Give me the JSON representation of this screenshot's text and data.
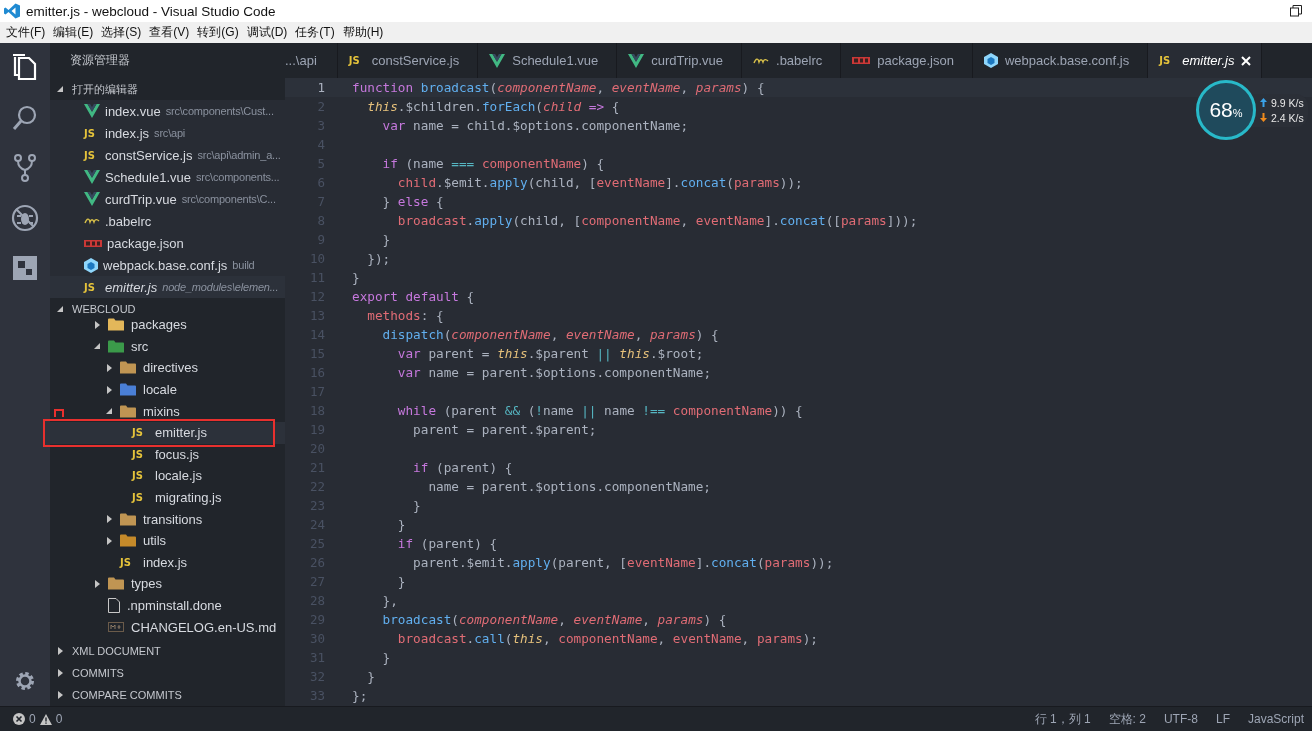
{
  "window": {
    "title": "emitter.js - webcloud - Visual Studio Code"
  },
  "menu": [
    "文件(F)",
    "编辑(E)",
    "选择(S)",
    "查看(V)",
    "转到(G)",
    "调试(D)",
    "任务(T)",
    "帮助(H)"
  ],
  "activity_bar": [
    {
      "kind": "explorer",
      "selected": true
    },
    {
      "kind": "search",
      "selected": false
    },
    {
      "kind": "git",
      "selected": false
    },
    {
      "kind": "debug",
      "selected": false
    },
    {
      "kind": "extensions",
      "selected": false
    }
  ],
  "sidebar": {
    "title": "资源管理器",
    "open_editors": {
      "title": "打开的编辑器",
      "expanded": true,
      "items": [
        {
          "kind": "vue",
          "name": "index.vue",
          "path": "src\\components\\Cust...",
          "selected": false,
          "preview": false
        },
        {
          "kind": "js",
          "badge": "JS",
          "name": "index.js",
          "path": "src\\api",
          "selected": false,
          "preview": false
        },
        {
          "kind": "js",
          "badge": "JS",
          "name": "constService.js",
          "path": "src\\api\\admin_a...",
          "selected": false,
          "preview": false
        },
        {
          "kind": "vue",
          "name": "Schedule1.vue",
          "path": "src\\components...",
          "selected": false,
          "preview": false
        },
        {
          "kind": "vue",
          "name": "curdTrip.vue",
          "path": "src\\components\\C...",
          "selected": false,
          "preview": false
        },
        {
          "kind": "babel",
          "name": ".babelrc",
          "selected": false,
          "preview": false
        },
        {
          "kind": "npm",
          "name": "package.json",
          "selected": false,
          "preview": false
        },
        {
          "kind": "webpack",
          "name": "webpack.base.conf.js",
          "path": "build",
          "selected": false,
          "preview": false
        },
        {
          "kind": "js",
          "badge": "JS",
          "name": "emitter.js",
          "path": "node_modules\\elemen...",
          "selected": true,
          "preview": true
        }
      ]
    },
    "project": {
      "title": "WEBCLOUD",
      "expanded": true,
      "items": [
        {
          "kind": "packages-folder",
          "name": "packages",
          "expanded": false,
          "selected": false
        },
        {
          "kind": "src-folder",
          "name": "src",
          "expanded": true,
          "selected": false,
          "children": [
            {
              "kind": "folder",
              "name": "directives",
              "expanded": false,
              "selected": false
            },
            {
              "kind": "locale-folder",
              "name": "locale",
              "expanded": false,
              "selected": false
            },
            {
              "kind": "folder",
              "name": "mixins",
              "expanded": true,
              "selected": false,
              "children": [
                {
                  "kind": "js",
                  "badge": "JS",
                  "name": "emitter.js",
                  "selected": true
                },
                {
                  "kind": "js",
                  "badge": "JS",
                  "name": "focus.js",
                  "selected": false
                },
                {
                  "kind": "js",
                  "badge": "JS",
                  "name": "locale.js",
                  "selected": false
                },
                {
                  "kind": "js",
                  "badge": "JS",
                  "name": "migrating.js",
                  "selected": false
                }
              ]
            },
            {
              "kind": "folder",
              "name": "transitions",
              "expanded": false,
              "selected": false
            },
            {
              "kind": "utils-folder",
              "name": "utils",
              "expanded": false,
              "selected": false
            },
            {
              "kind": "js",
              "badge": "JS",
              "name": "index.js",
              "selected": false
            }
          ]
        },
        {
          "kind": "folder",
          "name": "types",
          "expanded": false,
          "selected": false
        },
        {
          "kind": "file",
          "name": ".npminstall.done",
          "selected": false
        },
        {
          "kind": "md",
          "name": "CHANGELOG.en-US.md",
          "selected": false
        }
      ]
    },
    "sections": [
      {
        "title": "XML DOCUMENT",
        "expanded": false
      },
      {
        "title": "COMMITS",
        "expanded": false
      },
      {
        "title": "COMPARE COMMITS",
        "expanded": false
      }
    ]
  },
  "tabs": [
    {
      "kind": "none",
      "label": "...\\api",
      "selected": false
    },
    {
      "kind": "js",
      "badge": "JS",
      "label": "constService.js",
      "selected": false
    },
    {
      "kind": "vue",
      "label": "Schedule1.vue",
      "selected": false
    },
    {
      "kind": "vue",
      "label": "curdTrip.vue",
      "selected": false
    },
    {
      "kind": "babel",
      "label": ".babelrc",
      "selected": false
    },
    {
      "kind": "npm",
      "label": "package.json",
      "selected": false
    },
    {
      "kind": "webpack",
      "label": "webpack.base.conf.js",
      "selected": false
    },
    {
      "kind": "js",
      "badge": "JS",
      "label": "emitter.js",
      "selected": true
    }
  ],
  "editor": {
    "lines": [
      {
        "n": "1",
        "current": true,
        "tokens": [
          {
            "text": "function ",
            "kind": "kw"
          },
          {
            "text": "broadcast",
            "kind": "fn"
          },
          {
            "text": "(",
            "kind": "p"
          },
          {
            "text": "componentName",
            "kind": "param"
          },
          {
            "text": ", ",
            "kind": "p"
          },
          {
            "text": "eventName",
            "kind": "param"
          },
          {
            "text": ", ",
            "kind": "p"
          },
          {
            "text": "params",
            "kind": "param"
          },
          {
            "text": ") {",
            "kind": "p"
          }
        ]
      },
      {
        "n": "2",
        "current": false,
        "tokens": [
          {
            "text": "  this",
            "kind": "this"
          },
          {
            "text": ".$children.",
            "kind": "p"
          },
          {
            "text": "forEach",
            "kind": "fn"
          },
          {
            "text": "(",
            "kind": "p"
          },
          {
            "text": "child",
            "kind": "param"
          },
          {
            "text": " =>",
            "kind": "kw"
          },
          {
            "text": " {",
            "kind": "p"
          }
        ]
      },
      {
        "n": "3",
        "current": false,
        "tokens": [
          {
            "text": "    var",
            "kind": "kw"
          },
          {
            "text": " name = child.$options.componentName;",
            "kind": "p"
          }
        ]
      },
      {
        "n": "4",
        "current": false
      },
      {
        "n": "5",
        "current": false,
        "tokens": [
          {
            "text": "    if",
            "kind": "kw"
          },
          {
            "text": " (name ",
            "kind": "p"
          },
          {
            "text": "===",
            "kind": "op"
          },
          {
            "text": " componentName",
            "kind": "var"
          },
          {
            "text": ") {",
            "kind": "p"
          }
        ]
      },
      {
        "n": "6",
        "current": false,
        "tokens": [
          {
            "text": "      child",
            "kind": "var"
          },
          {
            "text": ".$emit.",
            "kind": "p"
          },
          {
            "text": "apply",
            "kind": "fn"
          },
          {
            "text": "(child, [",
            "kind": "p"
          },
          {
            "text": "eventName",
            "kind": "var"
          },
          {
            "text": "].",
            "kind": "p"
          },
          {
            "text": "concat",
            "kind": "fn"
          },
          {
            "text": "(",
            "kind": "p"
          },
          {
            "text": "params",
            "kind": "var"
          },
          {
            "text": "));",
            "kind": "p"
          }
        ]
      },
      {
        "n": "7",
        "current": false,
        "tokens": [
          {
            "text": "    } ",
            "kind": "p"
          },
          {
            "text": "else",
            "kind": "kw"
          },
          {
            "text": " {",
            "kind": "p"
          }
        ]
      },
      {
        "n": "8",
        "current": false,
        "tokens": [
          {
            "text": "      broadcast",
            "kind": "var"
          },
          {
            "text": ".",
            "kind": "p"
          },
          {
            "text": "apply",
            "kind": "fn"
          },
          {
            "text": "(child, [",
            "kind": "p"
          },
          {
            "text": "componentName",
            "kind": "var"
          },
          {
            "text": ", ",
            "kind": "p"
          },
          {
            "text": "eventName",
            "kind": "var"
          },
          {
            "text": "].",
            "kind": "p"
          },
          {
            "text": "concat",
            "kind": "fn"
          },
          {
            "text": "([",
            "kind": "p"
          },
          {
            "text": "params",
            "kind": "var"
          },
          {
            "text": "]));",
            "kind": "p"
          }
        ]
      },
      {
        "n": "9",
        "current": false,
        "tokens": [
          {
            "text": "    }",
            "kind": "p"
          }
        ]
      },
      {
        "n": "10",
        "current": false,
        "tokens": [
          {
            "text": "  });",
            "kind": "p"
          }
        ]
      },
      {
        "n": "11",
        "current": false,
        "tokens": [
          {
            "text": "}",
            "kind": "p"
          }
        ]
      },
      {
        "n": "12",
        "current": false,
        "tokens": [
          {
            "text": "export default",
            "kind": "kw"
          },
          {
            "text": " {",
            "kind": "p"
          }
        ]
      },
      {
        "n": "13",
        "current": false,
        "tokens": [
          {
            "text": "  methods",
            "kind": "var"
          },
          {
            "text": ": {",
            "kind": "p"
          }
        ]
      },
      {
        "n": "14",
        "current": false,
        "tokens": [
          {
            "text": "    dispatch",
            "kind": "fn"
          },
          {
            "text": "(",
            "kind": "p"
          },
          {
            "text": "componentName",
            "kind": "param"
          },
          {
            "text": ", ",
            "kind": "p"
          },
          {
            "text": "eventName",
            "kind": "param"
          },
          {
            "text": ", ",
            "kind": "p"
          },
          {
            "text": "params",
            "kind": "param"
          },
          {
            "text": ") {",
            "kind": "p"
          }
        ]
      },
      {
        "n": "15",
        "current": false,
        "tokens": [
          {
            "text": "      var",
            "kind": "kw"
          },
          {
            "text": " parent = ",
            "kind": "p"
          },
          {
            "text": "this",
            "kind": "this"
          },
          {
            "text": ".$parent ",
            "kind": "p"
          },
          {
            "text": "||",
            "kind": "op"
          },
          {
            "text": " this",
            "kind": "this"
          },
          {
            "text": ".$root;",
            "kind": "p"
          }
        ]
      },
      {
        "n": "16",
        "current": false,
        "tokens": [
          {
            "text": "      var",
            "kind": "kw"
          },
          {
            "text": " name = parent.$options.componentName;",
            "kind": "p"
          }
        ]
      },
      {
        "n": "17",
        "current": false
      },
      {
        "n": "18",
        "current": false,
        "tokens": [
          {
            "text": "      while",
            "kind": "kw"
          },
          {
            "text": " (parent ",
            "kind": "p"
          },
          {
            "text": "&&",
            "kind": "op"
          },
          {
            "text": " (",
            "kind": "p"
          },
          {
            "text": "!",
            "kind": "op"
          },
          {
            "text": "name ",
            "kind": "p"
          },
          {
            "text": "||",
            "kind": "op"
          },
          {
            "text": " name ",
            "kind": "p"
          },
          {
            "text": "!==",
            "kind": "op"
          },
          {
            "text": " componentName",
            "kind": "var"
          },
          {
            "text": ")) {",
            "kind": "p"
          }
        ]
      },
      {
        "n": "19",
        "current": false,
        "tokens": [
          {
            "text": "        parent = parent.$parent;",
            "kind": "p"
          }
        ]
      },
      {
        "n": "20",
        "current": false
      },
      {
        "n": "21",
        "current": false,
        "tokens": [
          {
            "text": "        if",
            "kind": "kw"
          },
          {
            "text": " (parent) {",
            "kind": "p"
          }
        ]
      },
      {
        "n": "22",
        "current": false,
        "tokens": [
          {
            "text": "          name = parent.$options.componentName;",
            "kind": "p"
          }
        ]
      },
      {
        "n": "23",
        "current": false,
        "tokens": [
          {
            "text": "        }",
            "kind": "p"
          }
        ]
      },
      {
        "n": "24",
        "current": false,
        "tokens": [
          {
            "text": "      }",
            "kind": "p"
          }
        ]
      },
      {
        "n": "25",
        "current": false,
        "tokens": [
          {
            "text": "      if",
            "kind": "kw"
          },
          {
            "text": " (parent) {",
            "kind": "p"
          }
        ]
      },
      {
        "n": "26",
        "current": false,
        "tokens": [
          {
            "text": "        parent.$emit.",
            "kind": "p"
          },
          {
            "text": "apply",
            "kind": "fn"
          },
          {
            "text": "(parent, [",
            "kind": "p"
          },
          {
            "text": "eventName",
            "kind": "var"
          },
          {
            "text": "].",
            "kind": "p"
          },
          {
            "text": "concat",
            "kind": "fn"
          },
          {
            "text": "(",
            "kind": "p"
          },
          {
            "text": "params",
            "kind": "var"
          },
          {
            "text": "));",
            "kind": "p"
          }
        ]
      },
      {
        "n": "27",
        "current": false,
        "tokens": [
          {
            "text": "      }",
            "kind": "p"
          }
        ]
      },
      {
        "n": "28",
        "current": false,
        "tokens": [
          {
            "text": "    },",
            "kind": "p"
          }
        ]
      },
      {
        "n": "29",
        "current": false,
        "tokens": [
          {
            "text": "    broadcast",
            "kind": "fn"
          },
          {
            "text": "(",
            "kind": "p"
          },
          {
            "text": "componentName",
            "kind": "param"
          },
          {
            "text": ", ",
            "kind": "p"
          },
          {
            "text": "eventName",
            "kind": "param"
          },
          {
            "text": ", ",
            "kind": "p"
          },
          {
            "text": "params",
            "kind": "param"
          },
          {
            "text": ") {",
            "kind": "p"
          }
        ]
      },
      {
        "n": "30",
        "current": false,
        "tokens": [
          {
            "text": "      broadcast",
            "kind": "var"
          },
          {
            "text": ".",
            "kind": "p"
          },
          {
            "text": "call",
            "kind": "fn"
          },
          {
            "text": "(",
            "kind": "p"
          },
          {
            "text": "this",
            "kind": "this"
          },
          {
            "text": ", ",
            "kind": "p"
          },
          {
            "text": "componentName",
            "kind": "var"
          },
          {
            "text": ", ",
            "kind": "p"
          },
          {
            "text": "eventName",
            "kind": "var"
          },
          {
            "text": ", ",
            "kind": "p"
          },
          {
            "text": "params",
            "kind": "var"
          },
          {
            "text": ");",
            "kind": "p"
          }
        ]
      },
      {
        "n": "31",
        "current": false,
        "tokens": [
          {
            "text": "    }",
            "kind": "p"
          }
        ]
      },
      {
        "n": "32",
        "current": false,
        "tokens": [
          {
            "text": "  }",
            "kind": "p"
          }
        ]
      },
      {
        "n": "33",
        "current": false,
        "tokens": [
          {
            "text": "};",
            "kind": "p"
          }
        ]
      }
    ]
  },
  "net_monitor": {
    "percent": "68",
    "unit": "%",
    "upload": "9.9 K/s",
    "download": "2.4 K/s"
  },
  "status_bar": {
    "errors": "0",
    "warnings": "0",
    "items": [
      "行 1，列 1",
      "空格: 2",
      "UTF-8",
      "LF",
      "JavaScript"
    ]
  }
}
